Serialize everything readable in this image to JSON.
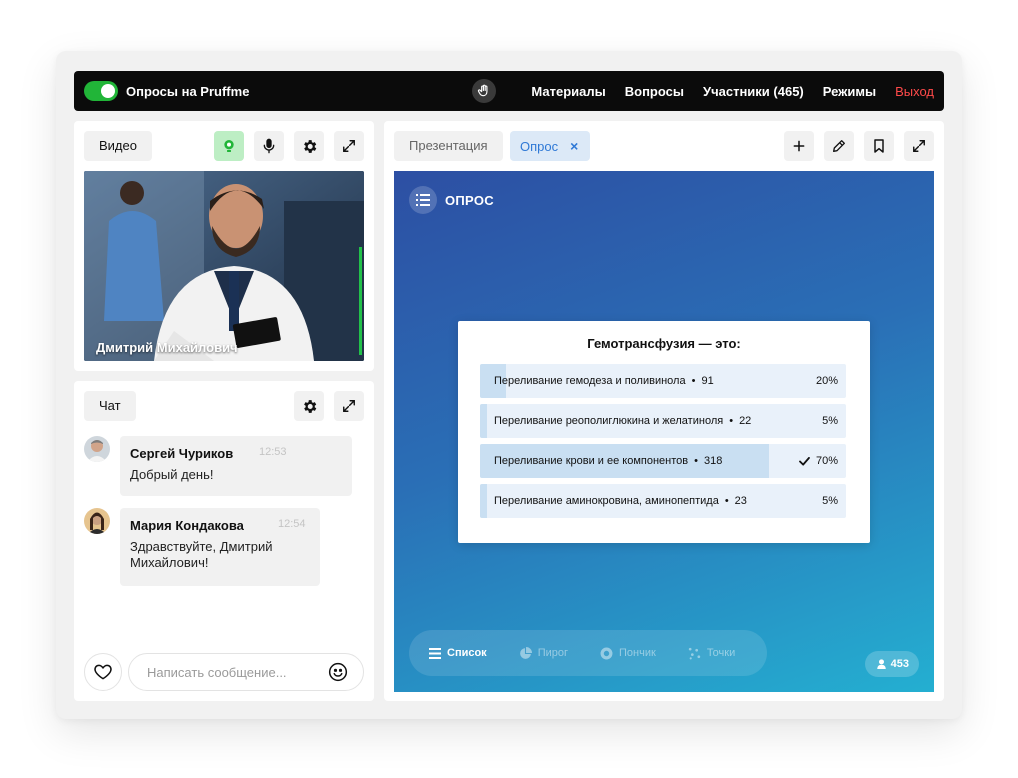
{
  "app": {
    "title": "Опросы на Pruffme",
    "toggle_on": true,
    "accent_color": "#21b538"
  },
  "nav": {
    "hand_icon": "hand-icon",
    "items": [
      "Материалы",
      "Вопросы",
      "Участники (465)",
      "Режимы"
    ],
    "exit": "Выход",
    "exit_color": "#ff4a4a"
  },
  "video": {
    "label": "Видео",
    "icons": [
      "webcam-icon",
      "microphone-icon",
      "gear-icon",
      "expand-icon"
    ],
    "speaker_name": "Дмитрий Михайлович"
  },
  "chat": {
    "label": "Чат",
    "icons": [
      "gear-icon",
      "expand-icon"
    ],
    "messages": [
      {
        "author": "Сергей Чуриков",
        "time": "12:53",
        "text": "Добрый день!"
      },
      {
        "author": "Мария Кондакова",
        "time": "12:54",
        "text": "Здравствуйте, Дмитрий Михайлович!"
      }
    ],
    "input_placeholder": "Написать сообщение...",
    "heart_icon": "heart-icon",
    "emoji_icon": "smiley-icon"
  },
  "main": {
    "tabs": [
      "Презентация",
      "Опрос"
    ],
    "active_tab": "Опрос",
    "toolbar_icons": [
      "plus-icon",
      "pen-icon",
      "bookmark-icon",
      "expand-icon"
    ]
  },
  "poll": {
    "header": "ОПРОС",
    "question": "Гемотрансфузия — это:",
    "answers": [
      {
        "text": "Переливание гемодеза и поливинола",
        "votes": "91",
        "percent": "20%",
        "fraction": 0.07,
        "correct": false
      },
      {
        "text": "Переливание реополиглюкина и желатиноля",
        "votes": "22",
        "percent": "5%",
        "fraction": 0.02,
        "correct": false
      },
      {
        "text": "Переливание крови и ее компонентов",
        "votes": "318",
        "percent": "70%",
        "fraction": 0.79,
        "correct": true
      },
      {
        "text": "Переливание аминокровина, аминопептида",
        "votes": "23",
        "percent": "5%",
        "fraction": 0.02,
        "correct": false
      }
    ],
    "chart_types": [
      {
        "label": "Список",
        "icon": "list-icon",
        "active": true
      },
      {
        "label": "Пирог",
        "icon": "pie-icon",
        "active": false
      },
      {
        "label": "Пончик",
        "icon": "donut-icon",
        "active": false
      },
      {
        "label": "Точки",
        "icon": "dots-icon",
        "active": false
      }
    ],
    "viewers": "453",
    "viewers_icon": "person-icon"
  }
}
